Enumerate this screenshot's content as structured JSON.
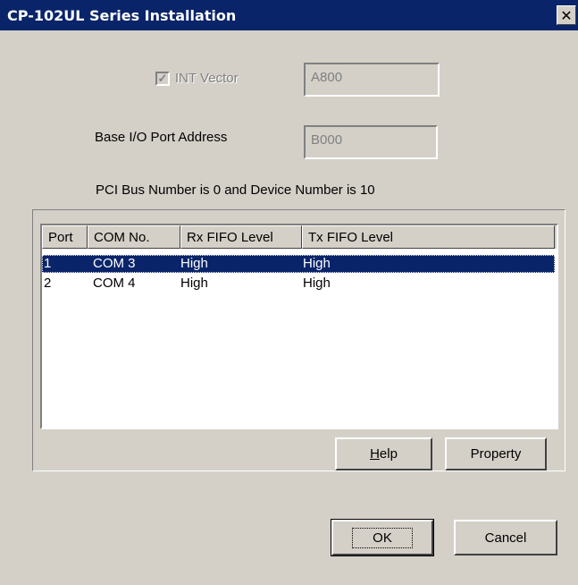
{
  "window": {
    "title": "CP-102UL Series Installation",
    "close_glyph": "✕"
  },
  "int_vector": {
    "label": "INT Vector",
    "checked": true,
    "value": "A800"
  },
  "base_io": {
    "label": "Base I/O Port Address",
    "value": "B000"
  },
  "pci_info": "PCI Bus Number is 0 and Device Number is 10",
  "table": {
    "columns": [
      "Port",
      "COM No.",
      "Rx FIFO Level",
      "Tx FIFO Level"
    ],
    "rows": [
      {
        "port": "1",
        "com": "COM 3",
        "rx": "High",
        "tx": "High",
        "selected": true
      },
      {
        "port": "2",
        "com": "COM 4",
        "rx": "High",
        "tx": "High",
        "selected": false
      }
    ]
  },
  "buttons": {
    "help_mnemonic": "H",
    "help_rest": "elp",
    "property": "Property",
    "ok": "OK",
    "cancel": "Cancel"
  },
  "colors": {
    "titlebar": "#0a246a",
    "face": "#d4d0c8",
    "selection": "#0a246a"
  }
}
